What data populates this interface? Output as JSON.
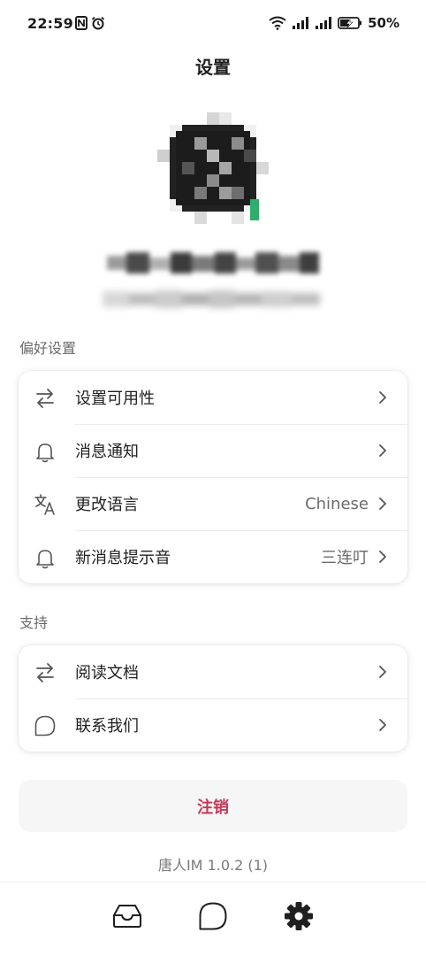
{
  "status_bar": {
    "time": "22:59",
    "battery": "50%",
    "icons": [
      "nfc-icon",
      "alarm-icon",
      "wifi-icon",
      "signal-icon",
      "signal-icon",
      "battery-charging-icon"
    ]
  },
  "header": {
    "title": "设置"
  },
  "profile": {
    "avatar_icon": "avatar-x-logo"
  },
  "preferences": {
    "label": "偏好设置",
    "items": [
      {
        "label": "设置可用性",
        "value": "",
        "icon": "swap-arrows-icon"
      },
      {
        "label": "消息通知",
        "value": "",
        "icon": "bell-icon"
      },
      {
        "label": "更改语言",
        "value": "Chinese",
        "icon": "translate-icon"
      },
      {
        "label": "新消息提示音",
        "value": "三连叮",
        "icon": "bell-icon"
      }
    ]
  },
  "support": {
    "label": "支持",
    "items": [
      {
        "label": "阅读文档",
        "value": "",
        "icon": "swap-arrows-icon"
      },
      {
        "label": "联系我们",
        "value": "",
        "icon": "chat-bubble-icon"
      }
    ]
  },
  "logout_label": "注销",
  "version": "唐人IM 1.0.2 (1)",
  "bottom_nav": [
    {
      "icon": "inbox-icon",
      "active": false
    },
    {
      "icon": "chat-bubble-icon",
      "active": false
    },
    {
      "icon": "gear-icon",
      "active": true
    }
  ],
  "colors": {
    "accent_red": "#c5395a",
    "online_green": "#2fae6b"
  }
}
